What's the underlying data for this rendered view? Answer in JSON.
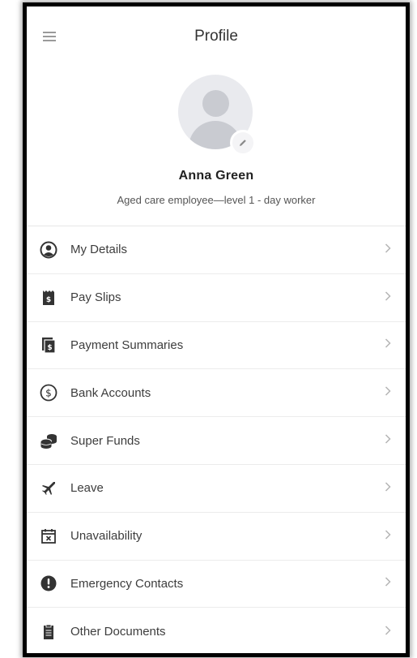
{
  "header": {
    "title": "Profile",
    "name": "Anna Green",
    "role": "Aged care employee—level 1 - day worker"
  },
  "menu": [
    {
      "label": "My Details",
      "icon": "user-circle-icon"
    },
    {
      "label": "Pay Slips",
      "icon": "pay-slip-icon"
    },
    {
      "label": "Payment Summaries",
      "icon": "payment-summary-icon"
    },
    {
      "label": "Bank Accounts",
      "icon": "dollar-circle-icon"
    },
    {
      "label": "Super Funds",
      "icon": "coins-icon"
    },
    {
      "label": "Leave",
      "icon": "plane-icon"
    },
    {
      "label": "Unavailability",
      "icon": "calendar-x-icon"
    },
    {
      "label": "Emergency Contacts",
      "icon": "alert-icon"
    },
    {
      "label": "Other Documents",
      "icon": "document-icon"
    }
  ],
  "colors": {
    "icon": "#333333",
    "chevron": "#b5b5b5",
    "avatar_bg": "#e9eaee",
    "avatar_fg": "#c9cbd1"
  }
}
